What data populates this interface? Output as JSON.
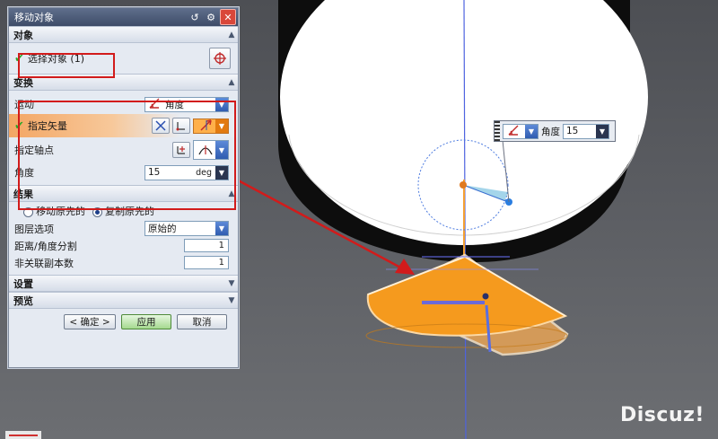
{
  "dialog": {
    "title": "移动对象",
    "sections": {
      "object": "对象",
      "transform": "变换",
      "result": "结果",
      "settings": "设置",
      "preview": "预览"
    },
    "select_object": "选择对象 (1)",
    "motion_label": "运动",
    "motion_value": "角度",
    "specify_vector": "指定矢量",
    "specify_pivot": "指定轴点",
    "angle_label": "角度",
    "angle_value": "15",
    "angle_unit": "deg",
    "move_original": "移动原先的",
    "copy_original": "复制原先的",
    "copy_selected": true,
    "layer_option_label": "图层选项",
    "layer_option_value": "原始的",
    "distance_angle_split_label": "距离/角度分割",
    "distance_angle_split_value": "1",
    "non_assoc_copies_label": "非关联副本数",
    "non_assoc_copies_value": "1",
    "ok_label": "< 确定 >",
    "apply_label": "应用",
    "cancel_label": "取消"
  },
  "floating_toolbar": {
    "label": "角度",
    "value": "15"
  },
  "watermark": "Discuz!",
  "colors": {
    "highlight_red": "#d21b1b",
    "cone_orange": "#f59a1e",
    "vector_blue": "#3a4fd8",
    "check_green": "#2ea52a"
  }
}
